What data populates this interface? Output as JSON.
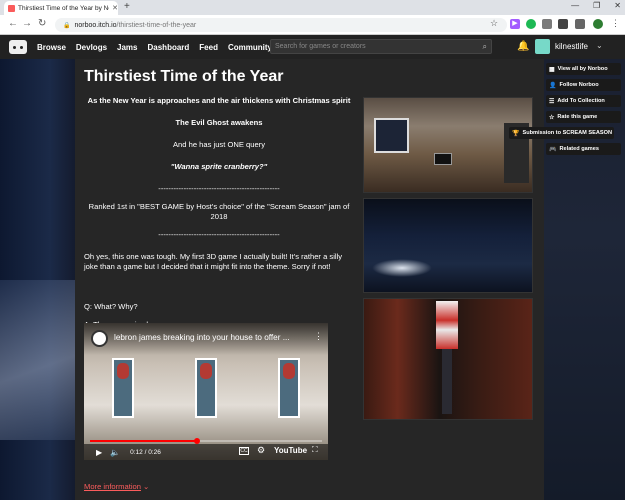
{
  "browser": {
    "tab_title": "Thirstiest Time of the Year by No",
    "url_domain": "norboo.itch.io",
    "url_path": "/thirstiest-time-of-the-year"
  },
  "topnav": {
    "links": [
      "Browse",
      "Devlogs",
      "Jams",
      "Dashboard",
      "Feed",
      "Community"
    ],
    "search_placeholder": "Search for games or creators",
    "username": "kilnestlife"
  },
  "page": {
    "title": "Thirstiest Time of the Year",
    "intro_lines": [
      "As the New Year is approaches and the air thickens with Christmas spirit",
      "The Evil Ghost awakens",
      "And he has just ONE query",
      "\"Wanna sprite cranberry?\"",
      "------------------------------------------------",
      "Ranked 1st in \"BEST GAME by Host's choice\" of the \"Scream Season\" jam of 2018",
      "------------------------------------------------"
    ],
    "para1": "Oh yes, this one was tough. My first 3D game I actually built! It's rather a silly joke than a game but I decided that it might fit into the theme. Sorry if not!",
    "q": "Q:  What? Why?",
    "a": "A: The answer is clear:",
    "more_information": "More information"
  },
  "video": {
    "title": "lebron james breaking into your house to offer ...",
    "time": "0:12 / 0:26",
    "cc": "CC",
    "brand": "YouTube",
    "progress": 0.46
  },
  "sidebar": {
    "view_all": "View all by Norboo",
    "follow": "Follow Norboo",
    "add_collection": "Add To Collection",
    "rate": "Rate this game",
    "submission": "Submission to SCREAM SEASON",
    "related": "Related games"
  },
  "colors": {
    "accent": "#fa5c5c",
    "page_bg": "#262626",
    "nav_bg": "#222222"
  }
}
